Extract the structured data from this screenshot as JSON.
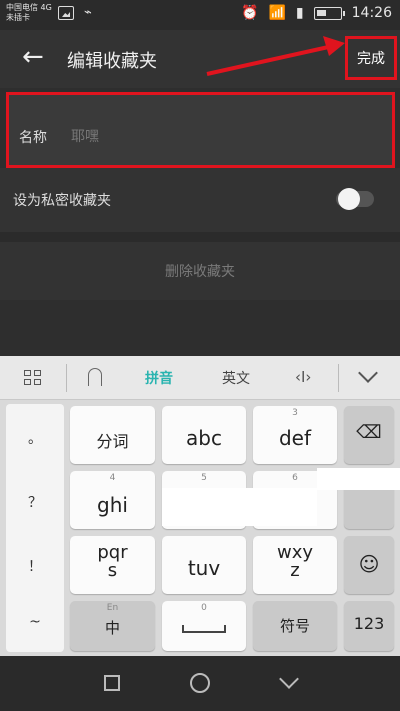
{
  "status_bar": {
    "carrier_line1": "中国电信 4G",
    "carrier_line2": "未插卡",
    "time": "14:26"
  },
  "app_bar": {
    "title": "编辑收藏夹",
    "done_label": "完成"
  },
  "form": {
    "name_label": "名称",
    "name_value": "耶嘿",
    "private_label": "设为私密收藏夹",
    "private_enabled": false,
    "delete_label": "删除收藏夹"
  },
  "keyboard": {
    "toolbar": {
      "pinyin": "拼音",
      "english": "英文",
      "cursor": "‹I›"
    },
    "left_symbols": [
      "。",
      "？",
      "！",
      "~"
    ],
    "keys": {
      "k1": {
        "main": "分词"
      },
      "k2": {
        "main": "abc"
      },
      "k3": {
        "num": "3",
        "main": "def"
      },
      "k4": {
        "num": "4",
        "main": "ghi"
      },
      "k5": {
        "num": "5"
      },
      "k6": {
        "num": "6"
      },
      "k7": {
        "main": "pqr\ns"
      },
      "k8": {
        "main": "tuv"
      },
      "k9": {
        "main": "wxy\nz"
      },
      "k_lang": {
        "num": "En",
        "main": "中"
      },
      "k_space": {
        "num": "0"
      },
      "k_symbol": {
        "main": "符号"
      },
      "k_num": {
        "main": "123"
      }
    }
  },
  "colors": {
    "highlight_red": "#e0141e",
    "pinyin_teal": "#2ab4b0"
  }
}
